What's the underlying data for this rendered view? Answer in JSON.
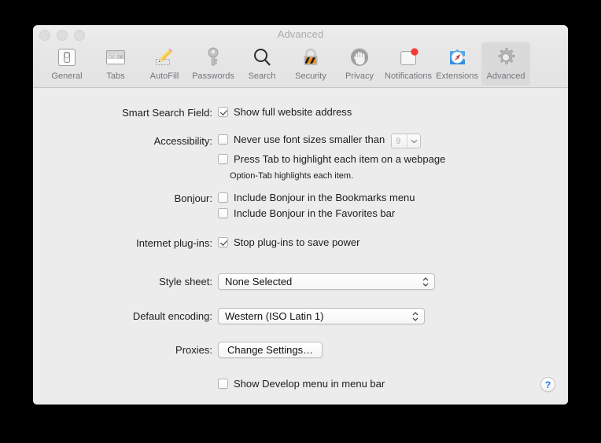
{
  "window": {
    "title": "Advanced",
    "traffic_lights": [
      "close",
      "minimize",
      "zoom"
    ]
  },
  "toolbar": {
    "items": [
      {
        "label": "General",
        "icon": "general-toggle-icon",
        "selected": false
      },
      {
        "label": "Tabs",
        "icon": "tabs-window-icon",
        "selected": false
      },
      {
        "label": "AutoFill",
        "icon": "autofill-pencil-icon",
        "selected": false
      },
      {
        "label": "Passwords",
        "icon": "key-icon",
        "selected": false
      },
      {
        "label": "Search",
        "icon": "magnifier-icon",
        "selected": false
      },
      {
        "label": "Security",
        "icon": "padlock-icon",
        "selected": false
      },
      {
        "label": "Privacy",
        "icon": "hand-icon",
        "selected": false
      },
      {
        "label": "Notifications",
        "icon": "notification-badge-icon",
        "selected": false
      },
      {
        "label": "Extensions",
        "icon": "puzzle-compass-icon",
        "selected": false
      },
      {
        "label": "Advanced",
        "icon": "gear-icon",
        "selected": true
      }
    ]
  },
  "form": {
    "smart_search": {
      "label": "Smart Search Field:",
      "checkbox_label": "Show full website address",
      "checked": true
    },
    "accessibility": {
      "label": "Accessibility:",
      "font_size_label": "Never use font sizes smaller than",
      "font_size_checked": false,
      "font_size_value": "9",
      "press_tab_label": "Press Tab to highlight each item on a webpage",
      "press_tab_checked": false,
      "hint": "Option-Tab highlights each item."
    },
    "bonjour": {
      "label": "Bonjour:",
      "bookmarks_label": "Include Bonjour in the Bookmarks menu",
      "bookmarks_checked": false,
      "favorites_label": "Include Bonjour in the Favorites bar",
      "favorites_checked": false
    },
    "plugins": {
      "label": "Internet plug-ins:",
      "checkbox_label": "Stop plug-ins to save power",
      "checked": true
    },
    "style_sheet": {
      "label": "Style sheet:",
      "value": "None Selected"
    },
    "default_encoding": {
      "label": "Default encoding:",
      "value": "Western (ISO Latin 1)"
    },
    "proxies": {
      "label": "Proxies:",
      "button_label": "Change Settings…"
    },
    "develop_menu": {
      "checkbox_label": "Show Develop menu in menu bar",
      "checked": false
    },
    "help_label": "?"
  },
  "colors": {
    "window_bg": "#ececec",
    "toolbar_bg": "#e6e6e6",
    "selected_tab_bg": "#dadada",
    "label_text": "#1d1d1d",
    "toolbar_label": "#74767c",
    "title_text": "#adacad",
    "help_blue": "#1878f0",
    "badge_red": "#f93a2f",
    "security_orange": "#f0901e"
  }
}
